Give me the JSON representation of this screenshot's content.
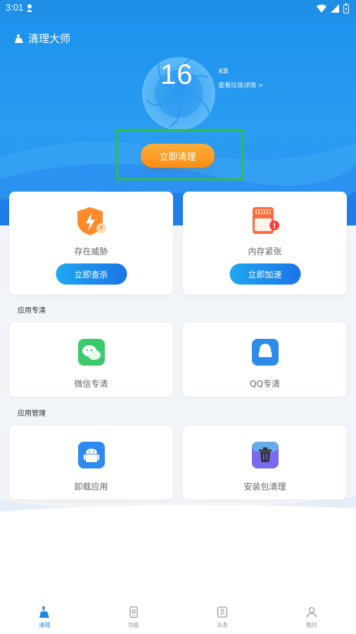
{
  "status_bar": {
    "time": "3:01"
  },
  "app": {
    "title": "清理大师"
  },
  "hero": {
    "size_value": "16",
    "size_unit": "KB",
    "detail_link": "查看垃圾详情 >",
    "clean_button": "立即清理"
  },
  "cards": {
    "threat": {
      "label": "存在威胁",
      "action": "立即查杀"
    },
    "memory": {
      "label": "内存紧张",
      "action": "立即加速"
    }
  },
  "sections": {
    "special_clean": {
      "title": "应用专清",
      "items": [
        {
          "label": "微信专清"
        },
        {
          "label": "QQ专清"
        }
      ]
    },
    "app_manage": {
      "title": "应用管理",
      "items": [
        {
          "label": "卸载应用"
        },
        {
          "label": "安装包清理"
        }
      ]
    }
  },
  "tabbar": {
    "tabs": [
      {
        "label": "清理",
        "icon": "broom-icon"
      },
      {
        "label": "功能",
        "icon": "phone-icon"
      },
      {
        "label": "头条",
        "icon": "news-icon"
      },
      {
        "label": "我的",
        "icon": "user-icon"
      }
    ]
  },
  "colors": {
    "primary_blue": "#1e93ee",
    "accent_orange": "#ff9a22",
    "highlight_green": "#2fbd47",
    "active_tab": "#1e88e5"
  }
}
